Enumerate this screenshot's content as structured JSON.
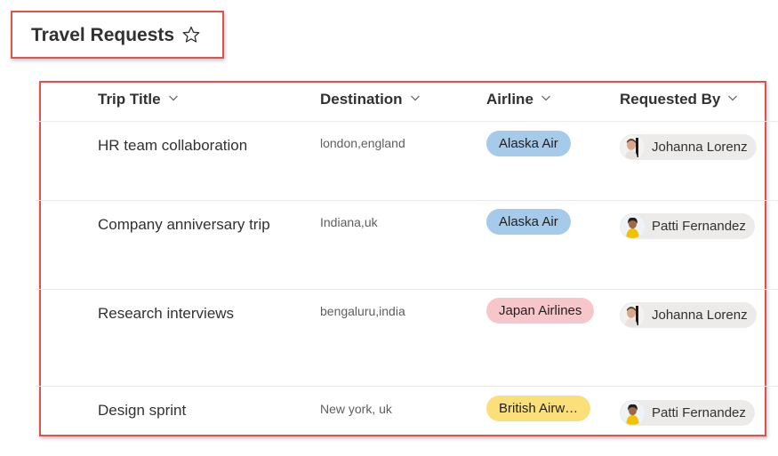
{
  "page": {
    "title": "Travel Requests"
  },
  "icons": {
    "favorite": "star-outline-icon",
    "sort": "chevron-down-icon"
  },
  "columns": [
    {
      "label": "Trip Title"
    },
    {
      "label": "Destination"
    },
    {
      "label": "Airline"
    },
    {
      "label": "Requested By"
    }
  ],
  "rows": [
    {
      "title": "HR team collaboration",
      "destination": "london,england",
      "airline": {
        "label": "Alaska Air",
        "color": "#a6cbea"
      },
      "requested_by": {
        "name": "Johanna Lorenz",
        "avatar": "johanna"
      }
    },
    {
      "title": "Company anniversary trip",
      "destination": "Indiana,uk",
      "airline": {
        "label": "Alaska Air",
        "color": "#a6cbea"
      },
      "requested_by": {
        "name": "Patti Fernandez",
        "avatar": "patti"
      }
    },
    {
      "title": "Research interviews",
      "destination": "bengaluru,india",
      "airline": {
        "label": "Japan Airlines",
        "color": "#f6c6cb"
      },
      "requested_by": {
        "name": "Johanna Lorenz",
        "avatar": "johanna"
      }
    },
    {
      "title": "Design sprint",
      "destination": "New york, uk",
      "airline": {
        "label": "British Airw…",
        "color": "#fbe07a"
      },
      "requested_by": {
        "name": "Patti Fernandez",
        "avatar": "patti"
      }
    }
  ],
  "annotation_color": "#e05252"
}
